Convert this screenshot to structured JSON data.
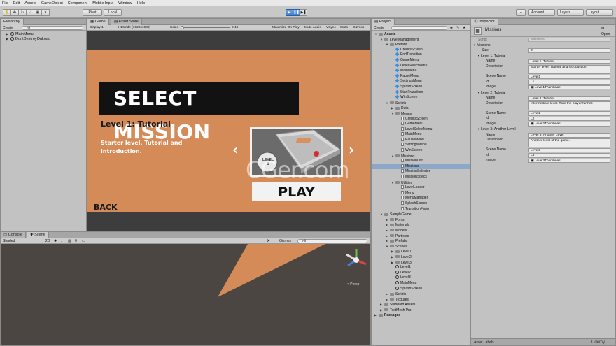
{
  "menubar": [
    "File",
    "Edit",
    "Assets",
    "GameObject",
    "Component",
    "Mobile Input",
    "Window",
    "Help"
  ],
  "toolbar": {
    "pivot": "Pivot",
    "local": "Local",
    "account": "Account",
    "layers": "Layers",
    "layout": "Layout"
  },
  "hierarchy": {
    "tab": "Hierarchy",
    "create": "Create",
    "search": "All",
    "items": [
      "MainMenu",
      "DontDestroyOnLoad"
    ]
  },
  "game": {
    "tab_game": "Game",
    "tab_asset_store": "Asset Store",
    "display": "Display 1",
    "resolution": "HDWide (1920x1080)",
    "scale_label": "Scale",
    "scale_value": "0.46",
    "maximize": "Maximize On Play",
    "mute": "Mute Audio",
    "vsync": "VSync",
    "stats": "Stats",
    "gizmos": "Gizmos",
    "screen": {
      "title": "SELECT MISSION",
      "level_title": "Level 1: Tutorial",
      "level_desc": "Starter level.  Tutorial and introduction.",
      "prev": "‹",
      "next": "›",
      "level_badge": "LEVEL 1",
      "play": "PLAY",
      "back": "BACK"
    }
  },
  "watermark": "CGer.com",
  "scene": {
    "tab_console": "Console",
    "tab_scene": "Scene",
    "shading": "Shaded",
    "mode_2d": "2D",
    "gizmos": "Gizmos",
    "search": "All",
    "persp": "< Persp"
  },
  "project": {
    "tab": "Project",
    "create": "Create",
    "rows": [
      {
        "label": "Assets",
        "indent": 0,
        "icon": "folder",
        "tri": "▼",
        "bold": true
      },
      {
        "label": "LevelManagement",
        "indent": 1,
        "icon": "folder",
        "tri": "▼"
      },
      {
        "label": "Prefabs",
        "indent": 2,
        "icon": "folder",
        "tri": "▼"
      },
      {
        "label": "CreditsScreen",
        "indent": 3,
        "icon": "prefab"
      },
      {
        "label": "EndTransition",
        "indent": 3,
        "icon": "prefab"
      },
      {
        "label": "GameMenu",
        "indent": 3,
        "icon": "prefab"
      },
      {
        "label": "LevelSelectMenu",
        "indent": 3,
        "icon": "prefab"
      },
      {
        "label": "MainMenu",
        "indent": 3,
        "icon": "prefab"
      },
      {
        "label": "PauseMenu",
        "indent": 3,
        "icon": "prefab"
      },
      {
        "label": "SettingsMenu",
        "indent": 3,
        "icon": "prefab"
      },
      {
        "label": "SplashScreen",
        "indent": 3,
        "icon": "prefab"
      },
      {
        "label": "StartTransition",
        "indent": 3,
        "icon": "prefab"
      },
      {
        "label": "WinScreen",
        "indent": 3,
        "icon": "prefab"
      },
      {
        "label": "Scripts",
        "indent": 2,
        "icon": "folder",
        "tri": "▼"
      },
      {
        "label": "Data",
        "indent": 3,
        "icon": "folder",
        "tri": "▶"
      },
      {
        "label": "Menus",
        "indent": 3,
        "icon": "folder",
        "tri": "▼"
      },
      {
        "label": "CreditsScreen",
        "indent": 4,
        "icon": "script"
      },
      {
        "label": "GameMenu",
        "indent": 4,
        "icon": "script"
      },
      {
        "label": "LevelSelectMenu",
        "indent": 4,
        "icon": "script"
      },
      {
        "label": "MainMenu",
        "indent": 4,
        "icon": "script"
      },
      {
        "label": "PauseMenu",
        "indent": 4,
        "icon": "script"
      },
      {
        "label": "SettingsMenu",
        "indent": 4,
        "icon": "script"
      },
      {
        "label": "WinScreen",
        "indent": 4,
        "icon": "script"
      },
      {
        "label": "Missions",
        "indent": 3,
        "icon": "folder",
        "tri": "▼"
      },
      {
        "label": "MissionList",
        "indent": 4,
        "icon": "script"
      },
      {
        "label": "Missions",
        "indent": 4,
        "icon": "script",
        "selected": true
      },
      {
        "label": "MissionSelector",
        "indent": 4,
        "icon": "script"
      },
      {
        "label": "MissionSpecs",
        "indent": 4,
        "icon": "script"
      },
      {
        "label": "Utilities",
        "indent": 3,
        "icon": "folder",
        "tri": "▼"
      },
      {
        "label": "LevelLoader",
        "indent": 4,
        "icon": "script"
      },
      {
        "label": "Menu",
        "indent": 4,
        "icon": "script"
      },
      {
        "label": "MenuManager",
        "indent": 4,
        "icon": "script"
      },
      {
        "label": "SplashScreen",
        "indent": 4,
        "icon": "script"
      },
      {
        "label": "TransitionFader",
        "indent": 4,
        "icon": "script"
      },
      {
        "label": "SampleGame",
        "indent": 1,
        "icon": "folder",
        "tri": "▼"
      },
      {
        "label": "Fonts",
        "indent": 2,
        "icon": "folder",
        "tri": "▶"
      },
      {
        "label": "Materials",
        "indent": 2,
        "icon": "folder",
        "tri": "▶"
      },
      {
        "label": "Models",
        "indent": 2,
        "icon": "folder",
        "tri": "▶"
      },
      {
        "label": "Particles",
        "indent": 2,
        "icon": "folder",
        "tri": "▶"
      },
      {
        "label": "Prefabs",
        "indent": 2,
        "icon": "folder",
        "tri": "▶"
      },
      {
        "label": "Scenes",
        "indent": 2,
        "icon": "folder",
        "tri": "▼"
      },
      {
        "label": "Level1",
        "indent": 3,
        "icon": "folder",
        "tri": "▶"
      },
      {
        "label": "Level2",
        "indent": 3,
        "icon": "folder",
        "tri": "▶"
      },
      {
        "label": "Level3",
        "indent": 3,
        "icon": "folder",
        "tri": "▶"
      },
      {
        "label": "Level1",
        "indent": 3,
        "icon": "unity"
      },
      {
        "label": "Level2",
        "indent": 3,
        "icon": "unity"
      },
      {
        "label": "Level3",
        "indent": 3,
        "icon": "unity"
      },
      {
        "label": "MainMenu",
        "indent": 3,
        "icon": "unity"
      },
      {
        "label": "SplashScreen",
        "indent": 3,
        "icon": "unity"
      },
      {
        "label": "Scripts",
        "indent": 2,
        "icon": "folder",
        "tri": "▶"
      },
      {
        "label": "Textures",
        "indent": 2,
        "icon": "folder",
        "tri": "▶"
      },
      {
        "label": "Standard Assets",
        "indent": 1,
        "icon": "folder",
        "tri": "▶"
      },
      {
        "label": "TextMesh Pro",
        "indent": 1,
        "icon": "folder",
        "tri": "▶"
      },
      {
        "label": "Packages",
        "indent": 0,
        "icon": "folder",
        "tri": "▶",
        "bold": true
      }
    ]
  },
  "inspector": {
    "tab": "Inspector",
    "object_name": "Missions",
    "open": "Open",
    "script_label": "Script",
    "script_value": "Missions",
    "rows": [
      {
        "label": "Missions",
        "indent": 0,
        "tri": "▼"
      },
      {
        "label": "Size",
        "indent": 2,
        "value": "3"
      },
      {
        "label": "Level 1: Tutorial",
        "indent": 1,
        "tri": "▼"
      },
      {
        "label": "Name",
        "indent": 3,
        "value": "Level 1: Tutorial"
      },
      {
        "label": "Description",
        "indent": 3,
        "value": "Starter level.  Tutorial and introduction.",
        "multi": true
      },
      {
        "label": "Scene Name",
        "indent": 3,
        "value": "Level1"
      },
      {
        "label": "Id",
        "indent": 3,
        "value": "L1"
      },
      {
        "label": "Image",
        "indent": 3,
        "value": "Level1Thumbnail"
      },
      {
        "label": "Level 2: Tutorial",
        "indent": 1,
        "tri": "▼"
      },
      {
        "label": "Name",
        "indent": 3,
        "value": "Level 2: Tutorial"
      },
      {
        "label": "Description",
        "indent": 3,
        "value": "Intermediate level.  Take the player further.",
        "multi": true
      },
      {
        "label": "Scene Name",
        "indent": 3,
        "value": "Level2"
      },
      {
        "label": "Id",
        "indent": 3,
        "value": "L2"
      },
      {
        "label": "Image",
        "indent": 3,
        "value": "Level2Thumbnail"
      },
      {
        "label": "Level 3: Another Level",
        "indent": 1,
        "tri": "▼"
      },
      {
        "label": "Name",
        "indent": 3,
        "value": "Level 3: Another Level"
      },
      {
        "label": "Description",
        "indent": 3,
        "value": "Another level of the game.",
        "multi": true
      },
      {
        "label": "Scene Name",
        "indent": 3,
        "value": "Level3"
      },
      {
        "label": "Id",
        "indent": 3,
        "value": "L3"
      },
      {
        "label": "Image",
        "indent": 3,
        "value": "Level3Thumbnail"
      }
    ],
    "asset_labels": "Asset Labels",
    "udemy": "Udemy"
  }
}
